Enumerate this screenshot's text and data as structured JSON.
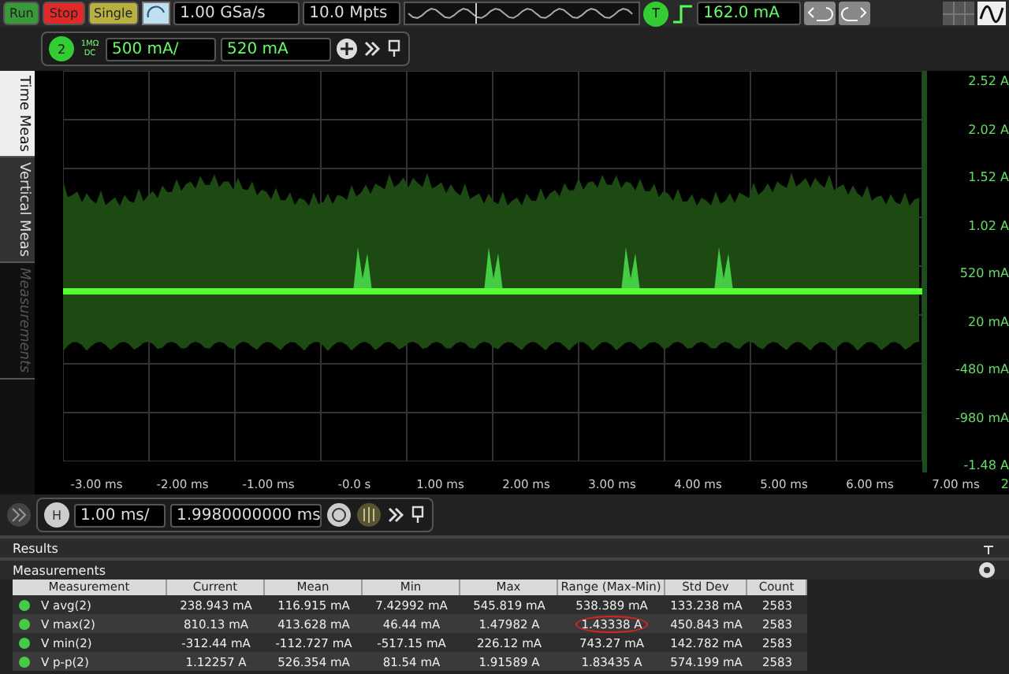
{
  "toolbar": {
    "run": "Run",
    "stop": "Stop",
    "single": "Single",
    "sample_rate": "1.00 GSa/s",
    "memory_depth": "10.0 Mpts",
    "trigger_badge": "T",
    "trigger_level": "162.0 mA"
  },
  "channel_bar": {
    "channel": "2",
    "coupling": "1MΩ DC",
    "scale": "500 mA/",
    "offset": "520 mA"
  },
  "side_tabs": [
    {
      "label": "Time Meas",
      "selected": true
    },
    {
      "label": "Vertical Meas",
      "selected": false
    },
    {
      "label": "Measurements",
      "selected": false
    }
  ],
  "plot": {
    "y_labels": [
      "2.52 A",
      "2.02 A",
      "1.52 A",
      "1.02 A",
      "520 mA",
      "20 mA",
      "-480 mA",
      "-980 mA",
      "-1.48 A"
    ],
    "x_labels": [
      "-3.00 ms",
      "-2.00 ms",
      "-1.00 ms",
      "-0.0 s",
      "1.00 ms",
      "2.00 ms",
      "3.00 ms",
      "4.00 ms",
      "5.00 ms",
      "6.00 ms",
      "7.00 ms"
    ],
    "edge_label": "2"
  },
  "horizontal_bar": {
    "badge": "H",
    "scale": "1.00 ms/",
    "position": "1.9980000000 ms"
  },
  "results": {
    "title": "Results",
    "panel": "Measurements",
    "columns": [
      "Measurement",
      "Current",
      "Mean",
      "Min",
      "Max",
      "Range (Max-Min)",
      "Std Dev",
      "Count"
    ],
    "rows": [
      {
        "cells": [
          {
            "text": "V avg(2)",
            "circled": false
          },
          {
            "text": "238.943 mA",
            "circled": false
          },
          {
            "text": "116.915 mA",
            "circled": false
          },
          {
            "text": "7.42992 mA",
            "circled": false
          },
          {
            "text": "545.819 mA",
            "circled": false
          },
          {
            "text": "538.389 mA",
            "circled": false
          },
          {
            "text": "133.238 mA",
            "circled": false
          },
          {
            "text": "2583",
            "circled": false
          }
        ]
      },
      {
        "cells": [
          {
            "text": "V max(2)",
            "circled": false
          },
          {
            "text": "810.13 mA",
            "circled": false
          },
          {
            "text": "413.628 mA",
            "circled": false
          },
          {
            "text": "46.44 mA",
            "circled": false
          },
          {
            "text": "1.47982 A",
            "circled": false
          },
          {
            "text": "1.43338 A",
            "circled": true
          },
          {
            "text": "450.843 mA",
            "circled": false
          },
          {
            "text": "2583",
            "circled": false
          }
        ]
      },
      {
        "cells": [
          {
            "text": "V min(2)",
            "circled": false
          },
          {
            "text": "-312.44 mA",
            "circled": false
          },
          {
            "text": "-112.727 mA",
            "circled": false
          },
          {
            "text": "-517.15 mA",
            "circled": false
          },
          {
            "text": "226.12 mA",
            "circled": false
          },
          {
            "text": "743.27 mA",
            "circled": false
          },
          {
            "text": "142.782 mA",
            "circled": false
          },
          {
            "text": "2583",
            "circled": false
          }
        ]
      },
      {
        "cells": [
          {
            "text": "V p-p(2)",
            "circled": false
          },
          {
            "text": "1.12257 A",
            "circled": false
          },
          {
            "text": "526.354 mA",
            "circled": false
          },
          {
            "text": "81.54 mA",
            "circled": false
          },
          {
            "text": "1.91589 A",
            "circled": false
          },
          {
            "text": "1.83435 A",
            "circled": false
          },
          {
            "text": "574.199 mA",
            "circled": false
          },
          {
            "text": "2583",
            "circled": false
          }
        ]
      }
    ]
  }
}
